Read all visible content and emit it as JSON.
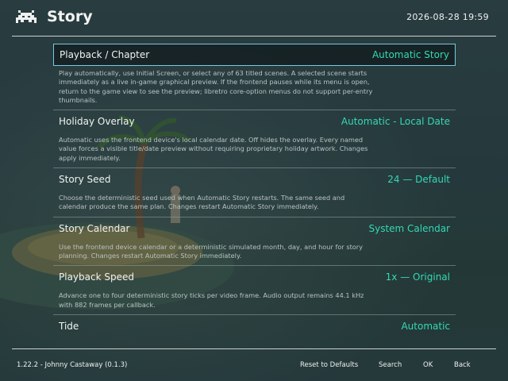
{
  "header": {
    "logo_icon": "space-invader-icon",
    "title": "Story",
    "clock": "2026-08-28 19:59"
  },
  "settings": [
    {
      "label": "Playback / Chapter",
      "value": "Automatic Story",
      "selected": true,
      "description": "Play automatically, use Initial Screen, or select any of 63 titled scenes. A selected scene starts immediately as a live in-game graphical preview. If the frontend pauses while its menu is open, return to the game view to see the preview; libretro core-option menus do not support per-entry thumbnails."
    },
    {
      "label": "Holiday Overlay",
      "value": "Automatic - Local Date",
      "selected": false,
      "description": "Automatic uses the frontend device's local calendar date. Off hides the overlay. Every named value forces a visible title/date preview without requiring proprietary holiday artwork. Changes apply immediately."
    },
    {
      "label": "Story Seed",
      "value": "24 — Default",
      "selected": false,
      "description": "Choose the deterministic seed used when Automatic Story restarts. The same seed and calendar produce the same plan. Changes restart Automatic Story immediately."
    },
    {
      "label": "Story Calendar",
      "value": "System Calendar",
      "selected": false,
      "description": "Use the frontend device calendar or a deterministic simulated month, day, and hour for story planning. Changes restart Automatic Story immediately."
    },
    {
      "label": "Playback Speed",
      "value": "1x — Original",
      "selected": false,
      "description": "Advance one to four deterministic story ticks per video frame. Audio output remains 44.1 kHz with 882 frames per callback."
    },
    {
      "label": "Tide",
      "value": "Automatic",
      "selected": false,
      "description": ""
    }
  ],
  "footer": {
    "core_info": "1.22.2 - Johnny Castaway (0.1.3)",
    "reset_label": "Reset to Defaults",
    "search_label": "Search",
    "ok_label": "OK",
    "back_label": "Back"
  },
  "colors": {
    "accent_value": "#34d8b4",
    "selection_border": "#79c8e0"
  }
}
